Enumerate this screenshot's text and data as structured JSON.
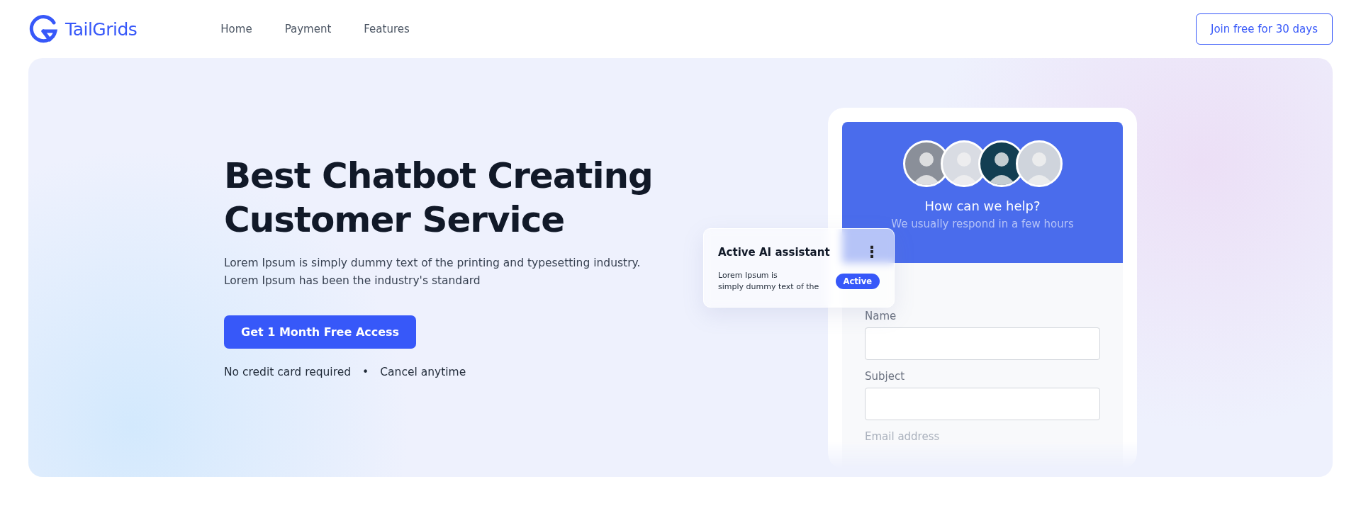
{
  "brand": {
    "name": "TailGrids"
  },
  "nav": [
    {
      "label": "Home"
    },
    {
      "label": "Payment"
    },
    {
      "label": "Features"
    }
  ],
  "header_button": "Join free for 30 days",
  "hero": {
    "title_lines": [
      "Best Chatbot Creating",
      "Customer Service"
    ],
    "description_lines": [
      "Lorem Ipsum is simply dummy text of the printing and typesetting industry.",
      "Lorem Ipsum has been the industry's standard"
    ],
    "cta": "Get 1 Month Free Access",
    "notes": [
      "No credit card required",
      "•",
      "Cancel anytime"
    ]
  },
  "chat_widget": {
    "title": "How can we help?",
    "subtitle": "We usually respond in a few hours",
    "fields": [
      {
        "label": "Name",
        "kind": "input"
      },
      {
        "label": "Subject",
        "kind": "input"
      },
      {
        "label": "Email address",
        "kind": "faded"
      }
    ]
  },
  "assistant_card": {
    "title": "Active AI assistant",
    "menu": "⋮",
    "text_lines": [
      "Lorem Ipsum is",
      "simply dummy text of the"
    ],
    "status": "Active"
  }
}
